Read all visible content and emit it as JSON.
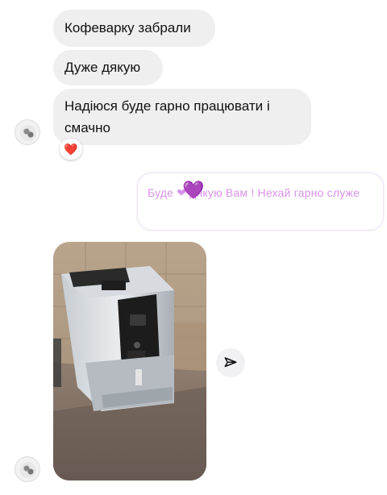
{
  "messages": [
    {
      "text": "Кофеварку забрали"
    },
    {
      "text": "Дуже дякую"
    },
    {
      "text": "Надіюся буде гарно працювати і смачно"
    }
  ],
  "reaction": {
    "emoji": "❤️"
  },
  "reply": {
    "text": "Буде ❤ дякую Вам ! Нехай гарно служе",
    "heart_emoji": "💜"
  },
  "photo": {
    "subject": "coffee-machine"
  },
  "icons": {
    "avatar": "avatar-icon",
    "forward": "share-arrow-icon"
  },
  "colors": {
    "bubble_bg": "#efeff0",
    "reply_text": "#cf7fe3",
    "purple_heart": "#c02bd0",
    "reaction_heart": "#e3143c"
  }
}
